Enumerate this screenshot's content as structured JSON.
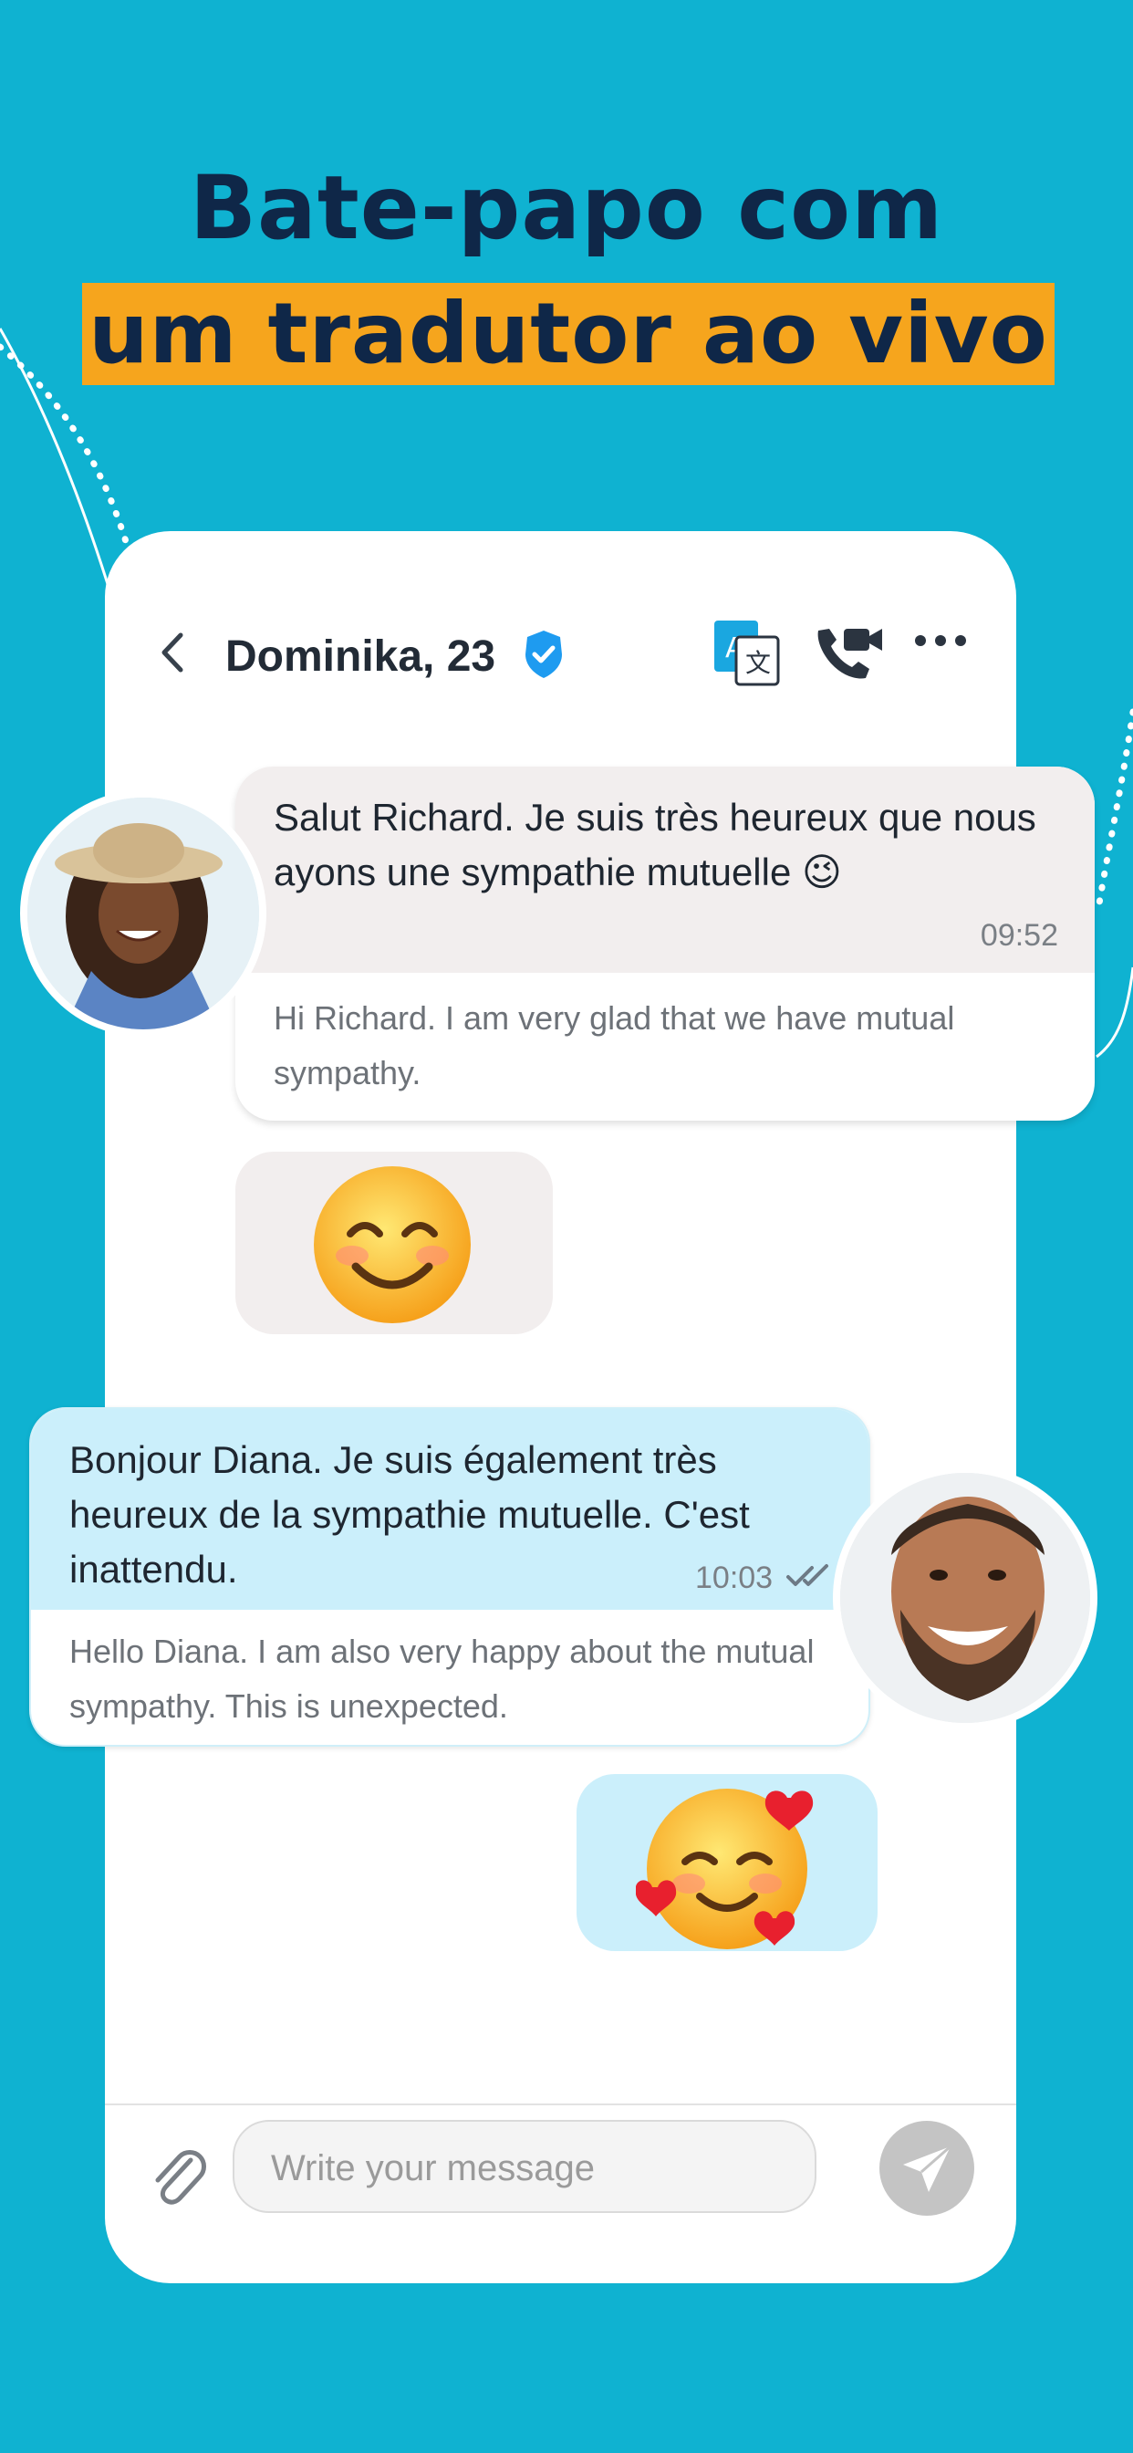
{
  "headline": {
    "line1": "Bate-papo com",
    "line2": "um tradutor ao vivo"
  },
  "chat_header": {
    "contact_name": "Dominika, 23",
    "icons": [
      "back-chevron-icon",
      "verified-badge-icon",
      "translate-icon",
      "video-call-icon",
      "more-options-icon"
    ]
  },
  "messages": [
    {
      "direction": "incoming",
      "text": "Salut Richard. Je suis très heureux que nous ayons une sympathie mutuelle 😉",
      "time": "09:52",
      "translation": "Hi Richard. I am very glad that we have mutual sympathy."
    },
    {
      "direction": "incoming",
      "emoji": "😊"
    },
    {
      "direction": "outgoing",
      "text": "Bonjour Diana. Je suis également très heureux de la sympathie mutuelle. C'est inattendu.",
      "time": "10:03",
      "translation": "Hello Diana. I am also very happy about the mutual sympathy. This is unexpected."
    },
    {
      "direction": "outgoing",
      "emoji": "🥰"
    }
  ],
  "composer": {
    "placeholder": "Write your message"
  },
  "colors": {
    "background": "#0fb2d1",
    "headline_text": "#0f2748",
    "highlight": "#f6a51d",
    "incoming_bubble": "#f2eeee",
    "outgoing_bubble": "#cbeffb",
    "verified": "#1e9bf0"
  }
}
